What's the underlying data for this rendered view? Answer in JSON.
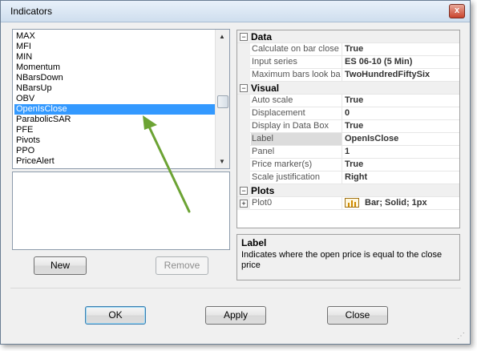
{
  "window": {
    "title": "Indicators",
    "close_label": "x"
  },
  "indicator_list": {
    "items": [
      "MAX",
      "MFI",
      "MIN",
      "Momentum",
      "NBarsDown",
      "NBarsUp",
      "OBV",
      "OpenIsClose",
      "ParabolicSAR",
      "PFE",
      "Pivots",
      "PPO",
      "PriceAlert"
    ],
    "selected": "OpenIsClose"
  },
  "buttons": {
    "new": "New",
    "remove": "Remove",
    "ok": "OK",
    "apply": "Apply",
    "close": "Close"
  },
  "properties": {
    "data": {
      "category": "Data",
      "rows": [
        {
          "name": "Calculate on bar close",
          "value": "True"
        },
        {
          "name": "Input series",
          "value": "ES 06-10 (5 Min)"
        },
        {
          "name": "Maximum bars look ba",
          "value": "TwoHundredFiftySix"
        }
      ]
    },
    "visual": {
      "category": "Visual",
      "rows": [
        {
          "name": "Auto scale",
          "value": "True"
        },
        {
          "name": "Displacement",
          "value": "0"
        },
        {
          "name": "Display in Data Box",
          "value": "True"
        },
        {
          "name": "Label",
          "value": "OpenIsClose"
        },
        {
          "name": "Panel",
          "value": "1"
        },
        {
          "name": "Price marker(s)",
          "value": "True"
        },
        {
          "name": "Scale justification",
          "value": "Right"
        }
      ]
    },
    "plots": {
      "category": "Plots",
      "rows": [
        {
          "name": "Plot0",
          "value": "Bar; Solid; 1px"
        }
      ]
    }
  },
  "help": {
    "title": "Label",
    "text": "Indicates where the open price is equal to the close price"
  },
  "colors": {
    "selection": "#3399ff",
    "arrow": "#6ca334"
  }
}
